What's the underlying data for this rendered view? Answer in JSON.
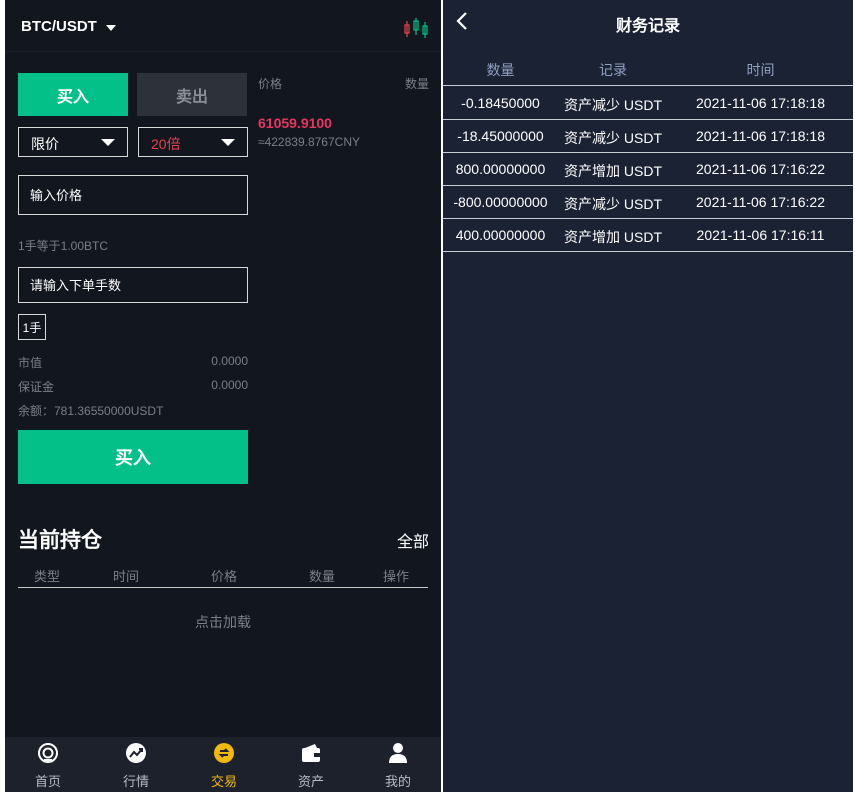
{
  "trade": {
    "pair": "BTC/USDT",
    "buy_tab": "买入",
    "sell_tab": "卖出",
    "order_type": "限价",
    "leverage": "20倍",
    "price_placeholder": "输入价格",
    "lot_note": "1手等于1.00BTC",
    "qty_placeholder": "请输入下单手数",
    "lot_button": "1手",
    "market_value_label": "市值",
    "market_value": "0.0000",
    "margin_label": "保证金",
    "margin": "0.0000",
    "balance": "余额：781.36550000USDT",
    "buy_button": "买入",
    "orderbook": {
      "price_header": "价格",
      "qty_header": "数量",
      "last_price": "61059.9100",
      "last_price_cny": "≈422839.8767CNY"
    },
    "positions": {
      "title": "当前持仓",
      "all_link": "全部",
      "columns": [
        "类型",
        "时间",
        "价格",
        "数量",
        "操作"
      ],
      "load_more": "点击加载"
    },
    "tabbar": [
      {
        "label": "首页",
        "icon": "home-icon"
      },
      {
        "label": "行情",
        "icon": "market-icon"
      },
      {
        "label": "交易",
        "icon": "trade-icon"
      },
      {
        "label": "资产",
        "icon": "wallet-icon"
      },
      {
        "label": "我的",
        "icon": "user-icon"
      }
    ]
  },
  "records": {
    "title": "财务记录",
    "columns": [
      "数量",
      "记录",
      "时间"
    ],
    "rows": [
      {
        "amount": "-0.18450000",
        "record": "资产减少 USDT",
        "time": "2021-11-06 17:18:18"
      },
      {
        "amount": "-18.45000000",
        "record": "资产减少 USDT",
        "time": "2021-11-06 17:18:18"
      },
      {
        "amount": "800.00000000",
        "record": "资产增加 USDT",
        "time": "2021-11-06 17:16:22"
      },
      {
        "amount": "-800.00000000",
        "record": "资产减少 USDT",
        "time": "2021-11-06 17:16:22"
      },
      {
        "amount": "400.00000000",
        "record": "资产增加 USDT",
        "time": "2021-11-06 17:16:11"
      }
    ]
  },
  "colors": {
    "buy_green": "#02c088",
    "sell_red": "#e8424c",
    "price_pink": "#e8365f",
    "active_tab": "#f0b90b",
    "left_bg": "#12161f",
    "right_bg": "#1b2233"
  }
}
